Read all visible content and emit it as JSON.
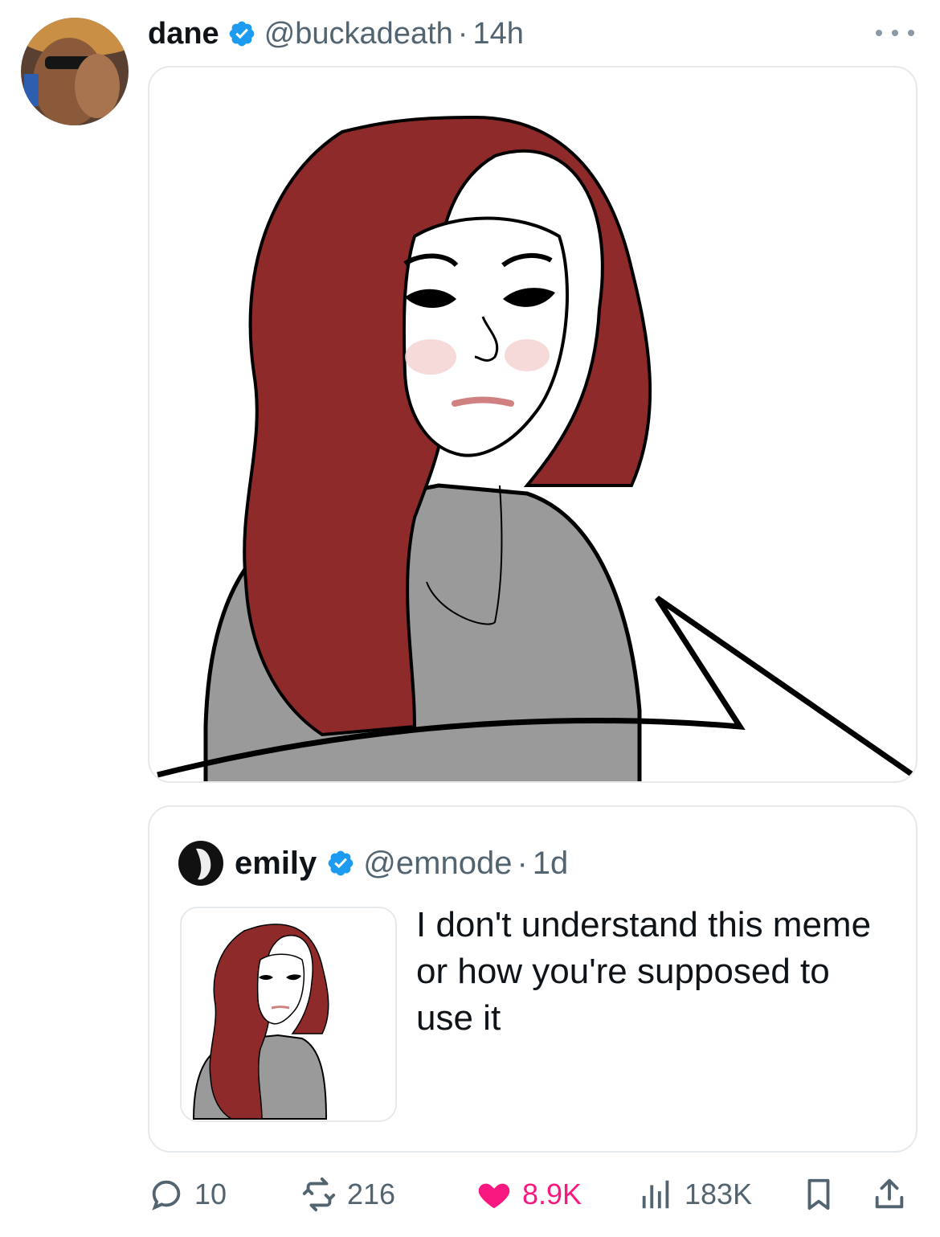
{
  "post": {
    "author": {
      "display_name": "dane",
      "handle": "@buckadeath",
      "separator": "·",
      "time": "14h",
      "verified": true
    },
    "media": {
      "description_icon": "meme-illustration"
    }
  },
  "quoted_post": {
    "author": {
      "display_name": "emily",
      "handle": "@emnode",
      "separator": "·",
      "time": "1d",
      "verified": true
    },
    "text": "I don't understand this meme or how you're supposed to use it"
  },
  "actions": {
    "replies": "10",
    "reposts": "216",
    "likes": "8.9K",
    "views": "183K",
    "liked": true
  },
  "colors": {
    "text_primary": "#0f1419",
    "text_secondary": "#536471",
    "verified_blue": "#1d9bf0",
    "like_pink": "#f91880",
    "border": "#e6e9ec",
    "hair_red": "#8e2a2a",
    "shirt_gray": "#9a9a9a"
  }
}
